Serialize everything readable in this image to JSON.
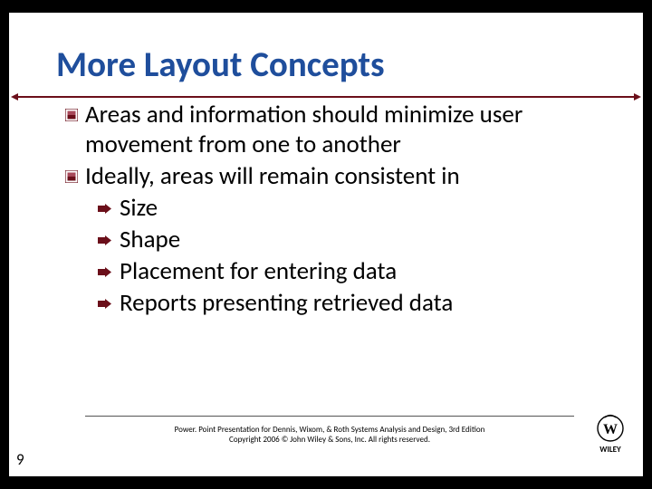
{
  "title": "More Layout Concepts",
  "bullets": {
    "b1a": "Areas and information should minimize user movement from one to another",
    "b1b": "Ideally, areas will remain consistent in",
    "b2a": "Size",
    "b2b": "Shape",
    "b2c": "Placement for entering data",
    "b2d": "Reports presenting retrieved data"
  },
  "footer": {
    "line1": "Power. Point Presentation for Dennis, Wixom, & Roth Systems Analysis and Design, 3rd Edition",
    "line2": "Copyright 2006 © John Wiley & Sons, Inc. All rights reserved."
  },
  "pageNumber": "9",
  "logoText": "WILEY"
}
